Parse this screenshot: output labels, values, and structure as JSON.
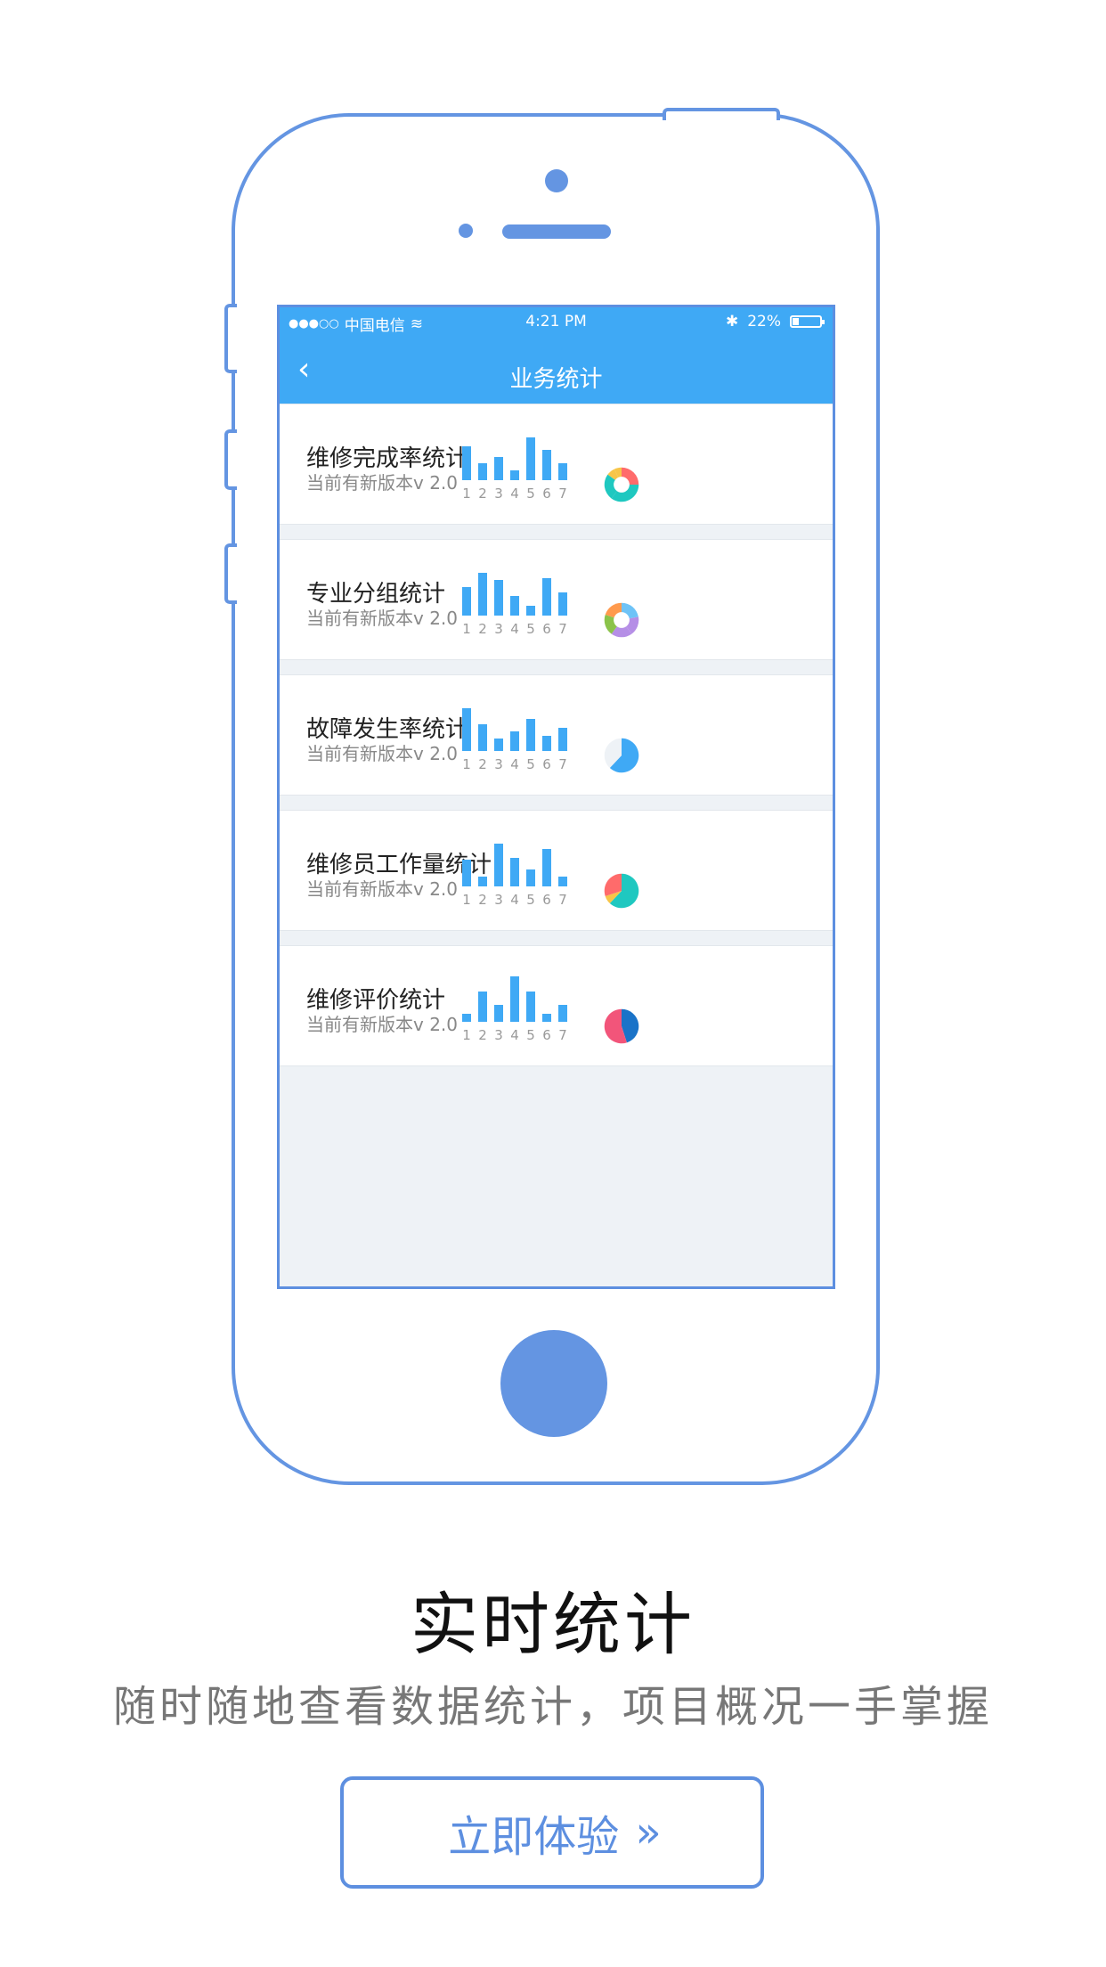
{
  "status_bar": {
    "signal": "●●●○○",
    "carrier": "中国电信",
    "wifi": "≋",
    "time": "4:21 PM",
    "bluetooth": "✱",
    "battery_text": "22%",
    "battery_level": 0.22
  },
  "nav": {
    "back_icon": "‹",
    "title": "业务统计"
  },
  "colors": {
    "accent": "#3fa9f5",
    "frame": "#6495e2",
    "button": "#5d8fe0"
  },
  "stats": [
    {
      "title": "维修完成率统计",
      "subtitle": "当前有新版本v  2.0",
      "bars": [
        0.62,
        0.3,
        0.42,
        0.18,
        0.78,
        0.55,
        0.3
      ],
      "ticks": [
        "1",
        "2",
        "3",
        "4",
        "5",
        "6",
        "7"
      ],
      "pie": {
        "kind": "donut",
        "slices": [
          {
            "value": 0.25,
            "color": "#ff6b6b"
          },
          {
            "value": 0.35,
            "color": "#1fc8c0"
          },
          {
            "value": 0.25,
            "color": "#1fc8c0"
          },
          {
            "value": 0.08,
            "color": "#f7c548"
          },
          {
            "value": 0.07,
            "color": "#f7c548"
          }
        ]
      }
    },
    {
      "title": "专业分组统计",
      "subtitle": "当前有新版本v  2.0",
      "bars": [
        0.52,
        0.78,
        0.65,
        0.35,
        0.18,
        0.68,
        0.42
      ],
      "ticks": [
        "1",
        "2",
        "3",
        "4",
        "5",
        "6",
        "7"
      ],
      "pie": {
        "kind": "donut",
        "slices": [
          {
            "value": 0.22,
            "color": "#6ec3f7"
          },
          {
            "value": 0.18,
            "color": "#b58ee6"
          },
          {
            "value": 0.2,
            "color": "#b58ee6"
          },
          {
            "value": 0.2,
            "color": "#8bc34a"
          },
          {
            "value": 0.2,
            "color": "#ff9a4d"
          }
        ]
      }
    },
    {
      "title": "故障发生率统计",
      "subtitle": "当前有新版本v  2.0",
      "bars": [
        0.78,
        0.48,
        0.22,
        0.35,
        0.58,
        0.28,
        0.42
      ],
      "ticks": [
        "1",
        "2",
        "3",
        "4",
        "5",
        "6",
        "7"
      ],
      "pie": {
        "kind": "pie",
        "slices": [
          {
            "value": 0.62,
            "color": "#3fa9f5"
          },
          {
            "value": 0.38,
            "color": "#eef2f6"
          }
        ]
      }
    },
    {
      "title": "维修员工作量统计",
      "subtitle": "当前有新版本v  2.0",
      "bars": [
        0.48,
        0.18,
        0.78,
        0.52,
        0.3,
        0.68,
        0.18
      ],
      "ticks": [
        "1",
        "2",
        "3",
        "4",
        "5",
        "6",
        "7"
      ],
      "pie": {
        "kind": "pie",
        "slices": [
          {
            "value": 0.62,
            "color": "#1fc8c0"
          },
          {
            "value": 0.08,
            "color": "#f7c548"
          },
          {
            "value": 0.3,
            "color": "#ff6b6b"
          }
        ]
      }
    },
    {
      "title": "维修评价统计",
      "subtitle": "当前有新版本v  2.0",
      "bars": [
        0.15,
        0.55,
        0.3,
        0.82,
        0.55,
        0.15,
        0.3
      ],
      "ticks": [
        "1",
        "2",
        "3",
        "4",
        "5",
        "6",
        "7"
      ],
      "pie": {
        "kind": "pie",
        "slices": [
          {
            "value": 0.45,
            "color": "#1a73c8"
          },
          {
            "value": 0.55,
            "color": "#f2557a"
          }
        ]
      }
    }
  ],
  "promo": {
    "headline": "实时统计",
    "subline": "随时随地查看数据统计，项目概况一手掌握",
    "cta_label": "立即体验",
    "cta_icon": "»"
  }
}
